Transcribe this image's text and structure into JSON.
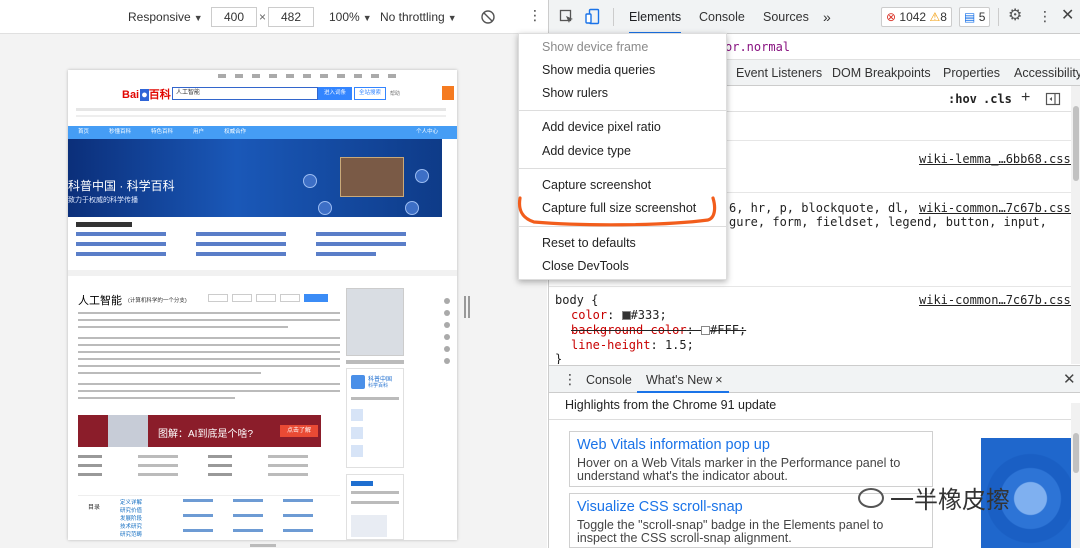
{
  "device_toolbar": {
    "device": "Responsive",
    "width": "400",
    "times": "×",
    "height": "482",
    "zoom": "100%",
    "throttle": "No throttling"
  },
  "devtools": {
    "tabs": [
      "Elements",
      "Console",
      "Sources"
    ],
    "more": "»",
    "errors": "1042",
    "warnings": "8",
    "messages": "5",
    "selector_tag": "or.normal",
    "styles_tabs": [
      "Event Listeners",
      "DOM Breakpoints",
      "Properties",
      "Accessibility"
    ],
    "hov": ":hov",
    "cls": ".cls",
    "plus": "+",
    "rules": [
      {
        "link": "wiki-lemma_…6bb68.css:6"
      },
      {
        "link": "wiki-common…7c67b.css:2",
        "line1": "6, hr, p, blockquote, dl,",
        "line2": "gure, form, fieldset, legend, button, input,"
      },
      {
        "link": "wiki-common…7c67b.css:2"
      }
    ],
    "body_rule": {
      "selector": "body {",
      "props": [
        {
          "name": "color",
          "value": "#333;",
          "swatch": "#333333"
        },
        {
          "name": "background-color",
          "value": "#FFF;",
          "swatch": "#ffffff"
        },
        {
          "name": "line-height",
          "value": "1.5;"
        }
      ],
      "close": "}"
    }
  },
  "menu": {
    "items": [
      {
        "label": "Show device frame",
        "disabled": true
      },
      {
        "label": "Show media queries"
      },
      {
        "label": "Show rulers"
      },
      {
        "label": "Add device pixel ratio"
      },
      {
        "label": "Add device type"
      },
      {
        "label": "Capture screenshot"
      },
      {
        "label": "Capture full size screenshot"
      },
      {
        "label": "Reset to defaults"
      },
      {
        "label": "Close DevTools"
      }
    ]
  },
  "drawer": {
    "tabs": [
      "Console",
      "What's New"
    ],
    "close_tab": "×",
    "highlights": "Highlights from the Chrome 91 update",
    "cards": [
      {
        "title": "Web Vitals information pop up",
        "body": "Hover on a Web Vitals marker in the Performance panel to understand what's the indicator about."
      },
      {
        "title": "Visualize CSS scroll-snap",
        "body": "Toggle the \"scroll-snap\" badge in the Elements panel to inspect the CSS scroll-snap alignment."
      }
    ]
  },
  "watermark": "一半橡皮擦",
  "baidu": {
    "logo_bai": "Bai",
    "logo_du": "百科",
    "search_value": "人工智能",
    "btn_enter": "进入词条",
    "btn_search": "全站搜索",
    "help": "帮助",
    "nav": [
      "首页",
      "秒懂百科",
      "特色百科",
      "用户",
      "权威合作",
      "个人中心"
    ],
    "banner_title": "科普中国 · 科学百科",
    "banner_sub": "致力于权威的科学传播",
    "article_title": "人工智能",
    "article_sub": "(计算机科学的一个分支)",
    "ad_text": "图解：AI到底是个啥?",
    "ad_btn": "点击了解",
    "side_title": "科普中国",
    "side_sub": "科学百科",
    "toc_label": "目录",
    "toc_items": [
      "定义详解",
      "研究价值",
      "发展阶段",
      "技术研究",
      "研究范畴",
      "实际应用"
    ]
  }
}
